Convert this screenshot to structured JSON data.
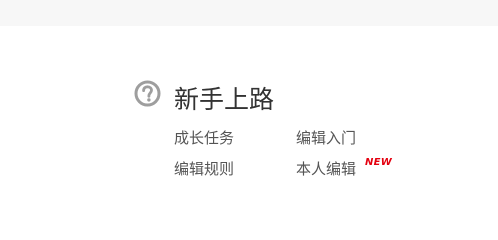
{
  "section": {
    "title": "新手上路",
    "icon": "question-circle-icon",
    "links": [
      {
        "label": "成长任务"
      },
      {
        "label": "编辑入门"
      },
      {
        "label": "编辑规则"
      },
      {
        "label": "本人编辑",
        "badge": "NEW"
      }
    ]
  },
  "colors": {
    "top_bar": "#f7f7f7",
    "icon": "#9e9e9e",
    "title": "#333333",
    "link": "#555555",
    "badge": "#e4000f"
  }
}
